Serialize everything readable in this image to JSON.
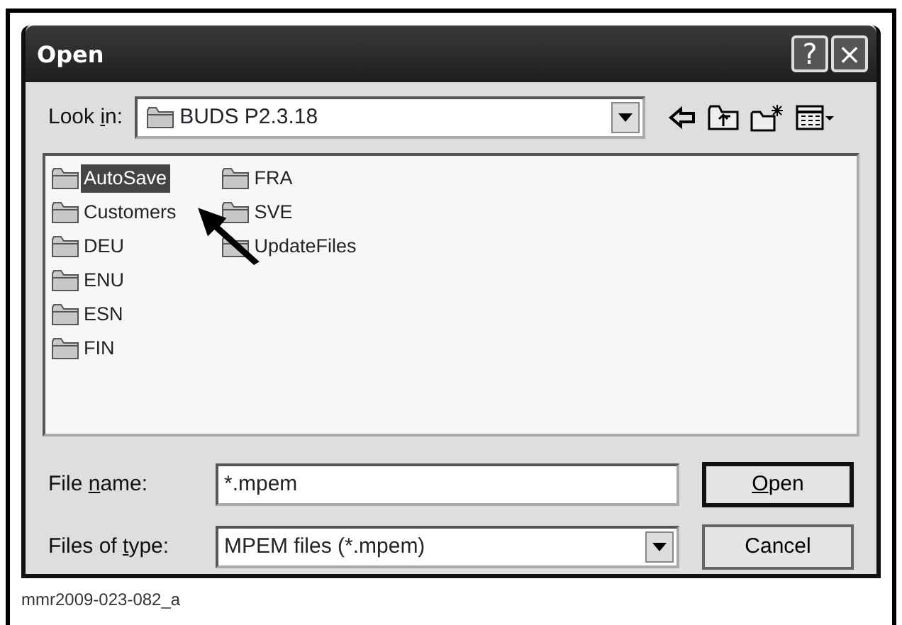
{
  "window": {
    "title": "Open",
    "help_button": "?",
    "close_button": "×"
  },
  "look_in": {
    "label_parts": [
      {
        "text": "Look ",
        "underline": false
      },
      {
        "text": "i",
        "underline": true
      },
      {
        "text": "n:",
        "underline": false
      }
    ],
    "value": "BUDS P2.3.18"
  },
  "files": [
    {
      "name": "AutoSave",
      "selected": true
    },
    {
      "name": "Customers",
      "selected": false
    },
    {
      "name": "DEU",
      "selected": false
    },
    {
      "name": "ENU",
      "selected": false
    },
    {
      "name": "ESN",
      "selected": false
    },
    {
      "name": "FIN",
      "selected": false
    },
    {
      "name": "FRA",
      "selected": false
    },
    {
      "name": "SVE",
      "selected": false
    },
    {
      "name": "UpdateFiles",
      "selected": false
    }
  ],
  "file_name": {
    "label_parts": [
      {
        "text": "File ",
        "underline": false
      },
      {
        "text": "n",
        "underline": true
      },
      {
        "text": "ame:",
        "underline": false
      }
    ],
    "value": "*.mpem"
  },
  "file_type": {
    "label_parts": [
      {
        "text": "Files of ",
        "underline": false
      },
      {
        "text": "t",
        "underline": true
      },
      {
        "text": "ype:",
        "underline": false
      }
    ],
    "value": "MPEM files (*.mpem)"
  },
  "buttons": [
    {
      "label_parts": [
        {
          "text": "O",
          "underline": true
        },
        {
          "text": "pen",
          "underline": false
        }
      ],
      "default": true
    },
    {
      "label_parts": [
        {
          "text": "Cancel",
          "underline": false
        }
      ],
      "default": false
    }
  ],
  "caption": "mmr2009-023-082_a"
}
